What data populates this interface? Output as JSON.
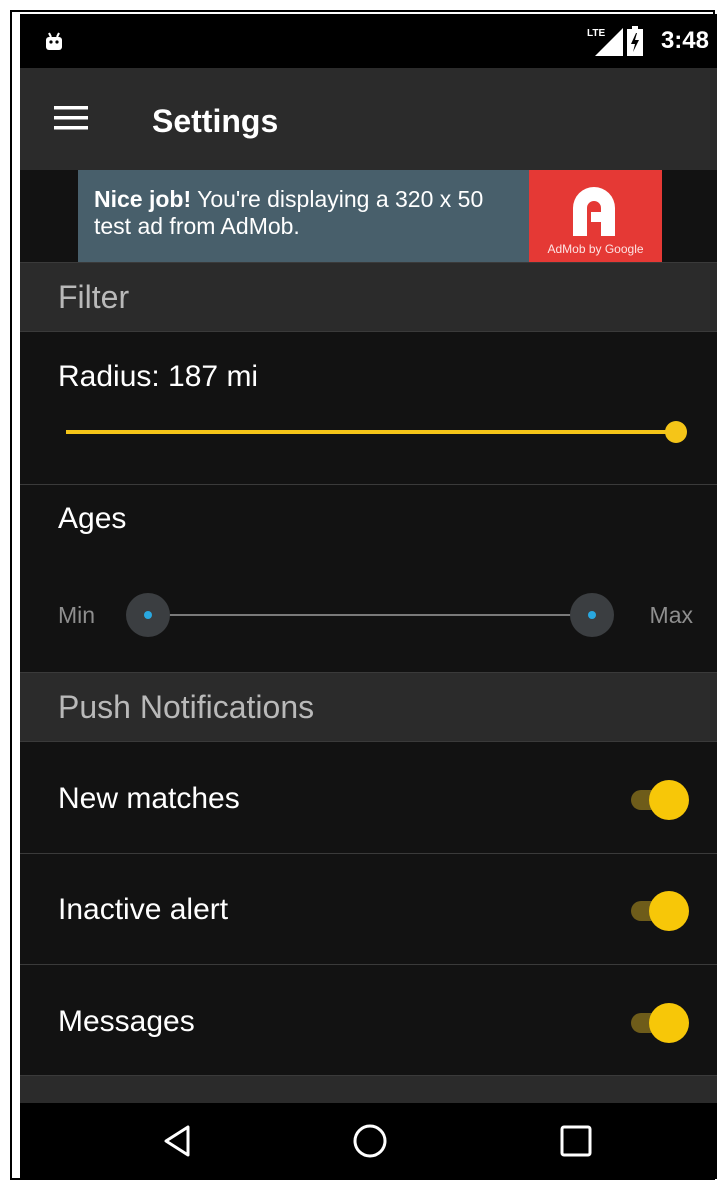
{
  "status_bar": {
    "network": "LTE",
    "time": "3:48"
  },
  "app_bar": {
    "title": "Settings",
    "menu_icon": "hamburger-menu-icon"
  },
  "ad": {
    "bold": "Nice job!",
    "text": " You're displaying a 320 x 50 test ad from AdMob.",
    "logo_caption": "AdMob by Google",
    "logo_color": "#e53935",
    "background": "#485f6b"
  },
  "filter": {
    "header": "Filter",
    "radius": {
      "label": "Radius: 187 mi",
      "fraction": 1.0
    },
    "ages": {
      "label": "Ages",
      "min_label": "Min",
      "max_label": "Max",
      "low_fraction": 0.0,
      "high_fraction": 1.0
    }
  },
  "push_notifications": {
    "header": "Push Notifications",
    "items": [
      {
        "label": "New matches",
        "enabled": true
      },
      {
        "label": "Inactive alert",
        "enabled": true
      },
      {
        "label": "Messages",
        "enabled": true
      }
    ]
  },
  "colors": {
    "accent": "#f5c518",
    "range_accent": "#29a8e0",
    "background": "#121212",
    "header_background": "#2b2b2b"
  },
  "nav_bar": {
    "back_icon": "back-triangle-icon",
    "home_icon": "home-circle-icon",
    "recents_icon": "recents-square-icon"
  }
}
